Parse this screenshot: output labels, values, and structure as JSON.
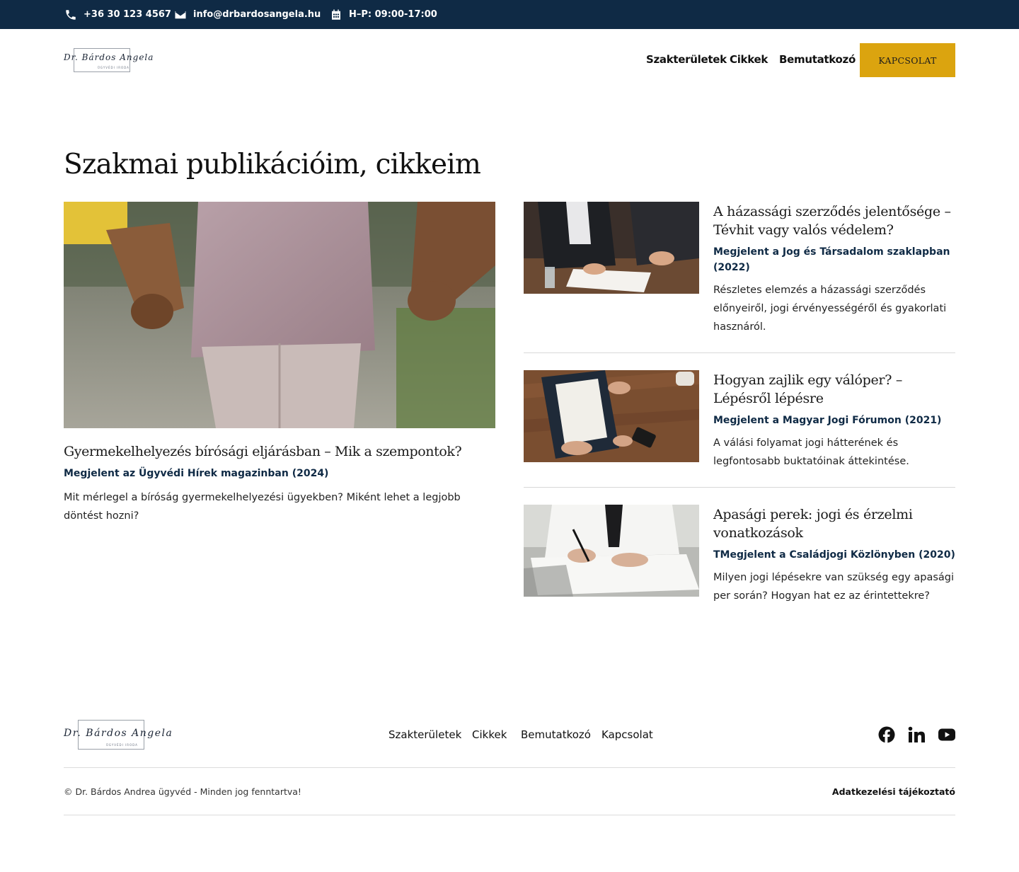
{
  "topbar": {
    "phone": "+36 30 123 4567",
    "email": "info@drbardosangela.hu",
    "hours": "H–P: 09:00-17:00"
  },
  "header": {
    "logo_text": "Dr. Bárdos Angela",
    "logo_sub": "ÜGYVÉDI IRODA",
    "nav": [
      "Szakterületek",
      "Cikkek",
      "Bemutatkozó"
    ],
    "cta": "KAPCSOLAT"
  },
  "page": {
    "title": "Szakmai publikációim, cikkeim"
  },
  "featured": {
    "title": "Gyermekelhelyezés bírósági eljárásban – Mik a szempontok?",
    "meta": "Megjelent az Ügyvédi Hírek magazinban (2024)",
    "desc": "Mit mérlegel a bíróság gyermekelhelyezési ügyekben? Miként lehet a legjobb döntést hozni?"
  },
  "articles": [
    {
      "title": "A házassági szerződés jelentősége – Tévhit vagy valós védelem?",
      "meta": "Megjelent a Jog és Társadalom szaklapban (2022)",
      "desc": "Részletes elemzés a házassági szerződés előnyeiről, jogi érvényességéről és gyakorlati hasznáról."
    },
    {
      "title": "Hogyan zajlik egy válóper? – Lépésről lépésre",
      "meta": "Megjelent a Magyar Jogi Fórumon (2021)",
      "desc": "A válási folyamat jogi hátterének és legfontosabb buktatóinak áttekintése."
    },
    {
      "title": "Apasági perek: jogi és érzelmi vonatkozások",
      "meta": "TMegjelent a Családjogi Közlönyben (2020)",
      "desc": "Milyen jogi lépésekre van szükség egy apasági per során? Hogyan hat ez az érintettekre?"
    }
  ],
  "footer": {
    "nav": [
      "Szakterületek",
      "Cikkek",
      "Bemutatkozó",
      "Kapcsolat"
    ],
    "social": [
      "facebook-icon",
      "linkedin-icon",
      "youtube-icon"
    ],
    "copyright": "© Dr. Bárdos Andrea ügyvéd - Minden jog fenntartva!",
    "policy": "Adatkezelési tájékoztató"
  },
  "colors": {
    "topbar": "#0f2a45",
    "accent": "#dba40f",
    "meta_text": "#0f2a45"
  }
}
